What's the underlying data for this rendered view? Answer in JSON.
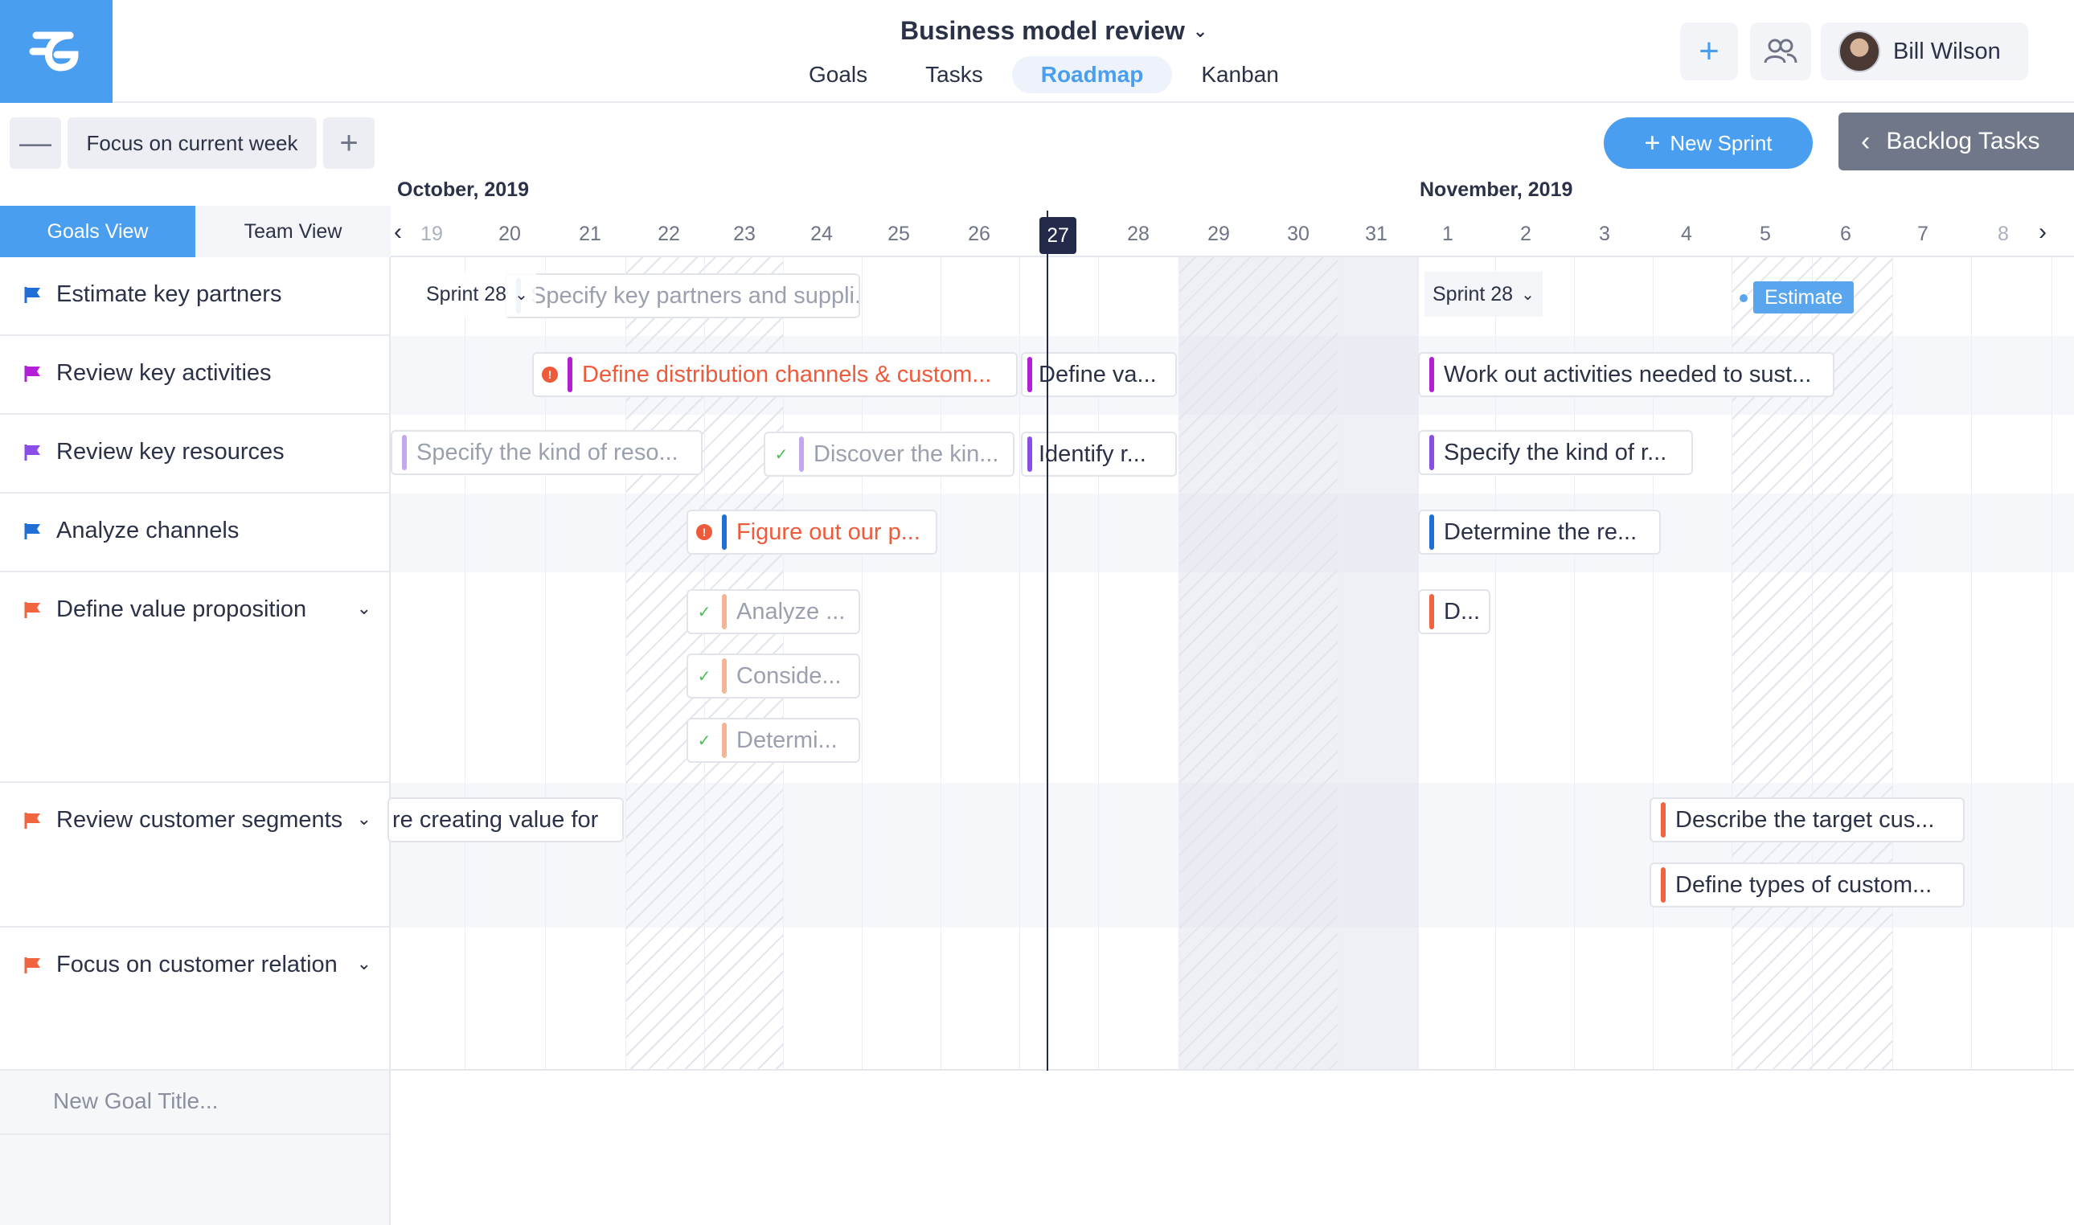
{
  "header": {
    "project_title": "Business model review",
    "nav": [
      "Goals",
      "Tasks",
      "Roadmap",
      "Kanban"
    ],
    "active_nav": "Roadmap",
    "user_name": "Bill Wilson"
  },
  "toolbar": {
    "minus": "—",
    "focus_label": "Focus on current week",
    "plus": "+",
    "new_sprint_label": "New Sprint",
    "backlog_label": "Backlog Tasks"
  },
  "timeline": {
    "months": [
      "October, 2019",
      "November, 2019"
    ],
    "dates": [
      "19",
      "20",
      "21",
      "22",
      "23",
      "24",
      "25",
      "26",
      "27",
      "28",
      "29",
      "30",
      "31",
      "1",
      "2",
      "3",
      "4",
      "5",
      "6",
      "7",
      "8"
    ],
    "today": "27"
  },
  "views": {
    "goals": "Goals View",
    "team": "Team View"
  },
  "goals": [
    {
      "title": "Estimate key partners",
      "color": "#1f6fd6",
      "expandable": false
    },
    {
      "title": "Review key activities",
      "color": "#b31fd6",
      "expandable": false
    },
    {
      "title": "Review key resources",
      "color": "#8a4de8",
      "expandable": false
    },
    {
      "title": "Analyze channels",
      "color": "#1f6fd6",
      "expandable": false
    },
    {
      "title": "Define value proposition",
      "color": "#f0643f",
      "expandable": true
    },
    {
      "title": "Review customer segments",
      "color": "#f0643f",
      "expandable": true
    },
    {
      "title": "Focus on customer relation",
      "color": "#f0643f",
      "expandable": true
    }
  ],
  "new_goal_placeholder": "New Goal Title...",
  "sprints": {
    "first": "Sprint 28",
    "second": "Sprint 28"
  },
  "estimate_label": "Estimate",
  "tasks": {
    "r1a": "Specify key partners and suppli...",
    "r2a": "Define distribution channels & custom...",
    "r2b": "Define va...",
    "r2c": "Work out activities needed to sust...",
    "r3a": "Specify the kind of reso...",
    "r3b": "Discover the kin...",
    "r3c": "Identify r...",
    "r3d": "Specify the kind of r...",
    "r4a": "Figure out our p...",
    "r4b": "Determine the re...",
    "r5a": "Analyze ...",
    "r5b": "Conside...",
    "r5c": "Determi...",
    "r5d": "D...",
    "r6a": "re creating value for",
    "r6b": "Describe the target cus...",
    "r6c": "Define types of custom..."
  },
  "colors": {
    "brand": "#4a9ef0",
    "today": "#232a4a",
    "alert": "#ee5a3a",
    "purple": "#b31fd6",
    "violet": "#8a4de8",
    "blue": "#1f6fd6",
    "orange": "#f0643f"
  }
}
